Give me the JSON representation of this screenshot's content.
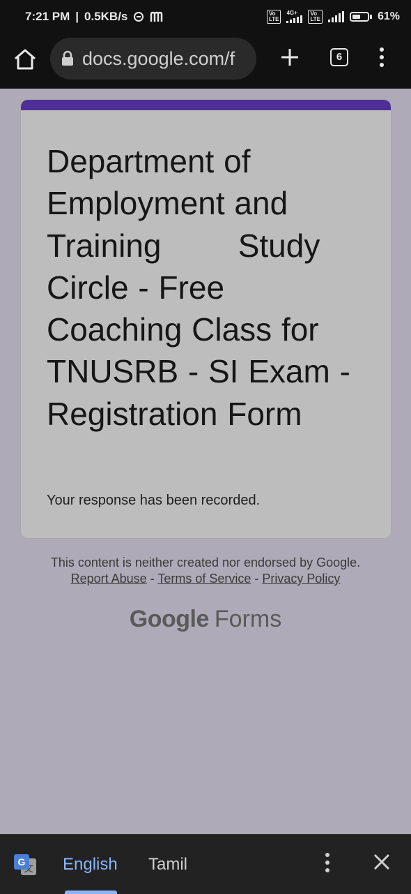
{
  "status": {
    "time": "7:21 PM",
    "speed": "0.5KB/s",
    "network_label": "4G+",
    "volte_label": "Vo\nLTE",
    "battery_percent": 61,
    "battery_label": "61%"
  },
  "toolbar": {
    "url": "docs.google.com/f",
    "tab_count": "6"
  },
  "form": {
    "title": "Department of Employment and Training        Study Circle - Free Coaching Class for TNUSRB - SI Exam - Registration Form",
    "confirmation": "Your response has been recorded."
  },
  "footer": {
    "note": "This content is neither created nor endorsed by Google.",
    "report_abuse": "Report Abuse",
    "terms": "Terms of Service",
    "privacy": "Privacy Policy",
    "separator": " - ",
    "brand_google": "Google",
    "brand_forms": "Forms"
  },
  "translate": {
    "lang_source": "English",
    "lang_target": "Tamil"
  },
  "colors": {
    "form_accent": "#4f2e96",
    "active_language": "#8ab4f8"
  }
}
